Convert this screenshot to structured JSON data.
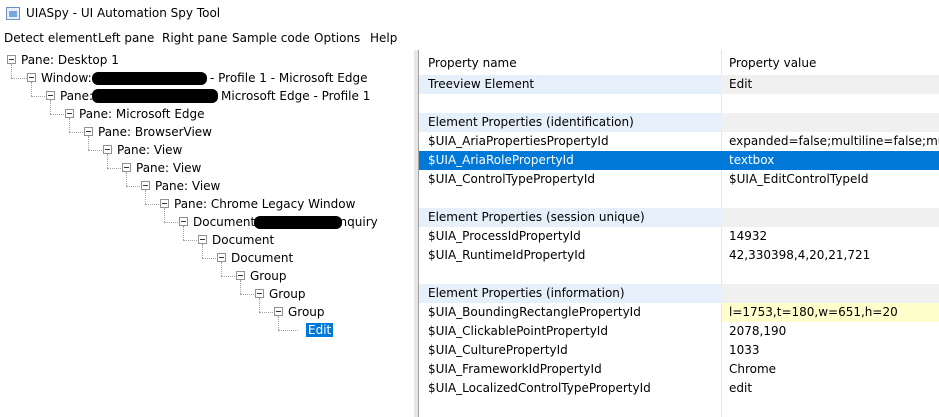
{
  "window": {
    "title": "UIASpy - UI Automation Spy Tool"
  },
  "menu": [
    {
      "label": "Detect element"
    },
    {
      "label": "Left pane"
    },
    {
      "label": "Right pane"
    },
    {
      "label": "Sample code"
    },
    {
      "label": "Options"
    },
    {
      "label": "Help"
    }
  ],
  "tree": [
    {
      "label": "Pane: Desktop 1"
    },
    {
      "label": "Window:",
      "label_suffix": "- Profile 1 - Microsoft Edge"
    },
    {
      "label": "Pane:",
      "label_suffix": "Microsoft Edge - Profile 1"
    },
    {
      "label": "Pane: Microsoft Edge"
    },
    {
      "label": "Pane: BrowserView"
    },
    {
      "label": "Pane: View"
    },
    {
      "label": "Pane: View"
    },
    {
      "label": "Pane: View"
    },
    {
      "label": "Pane: Chrome Legacy Window"
    },
    {
      "label": "Document:",
      "label_suffix": "Inquiry"
    },
    {
      "label": "Document"
    },
    {
      "label": "Document"
    },
    {
      "label": "Group"
    },
    {
      "label": "Group"
    },
    {
      "label": "Group"
    },
    {
      "label": "Edit",
      "selected": true
    }
  ],
  "grid": {
    "headers": {
      "name": "Property name",
      "value": "Property value"
    },
    "rows": [
      {
        "name": "Treeview Element",
        "value": "Edit",
        "type": "group"
      },
      {
        "name": "",
        "value": "",
        "type": "blank"
      },
      {
        "name": "Element Properties (identification)",
        "value": "",
        "type": "group"
      },
      {
        "name": "$UIA_AriaPropertiesPropertyId",
        "value": "expanded=false;multiline=false;multiselectable=false",
        "type": "normal"
      },
      {
        "name": "$UIA_AriaRolePropertyId",
        "value": "textbox",
        "type": "selected"
      },
      {
        "name": "$UIA_ControlTypePropertyId",
        "value": "$UIA_EditControlTypeId",
        "type": "normal"
      },
      {
        "name": "",
        "value": "",
        "type": "blank"
      },
      {
        "name": "Element Properties (session unique)",
        "value": "",
        "type": "group"
      },
      {
        "name": "$UIA_ProcessIdPropertyId",
        "value": "14932",
        "type": "normal"
      },
      {
        "name": "$UIA_RuntimeIdPropertyId",
        "value": "42,330398,4,20,21,721",
        "type": "normal"
      },
      {
        "name": "",
        "value": "",
        "type": "blank"
      },
      {
        "name": "Element Properties (information)",
        "value": "",
        "type": "group"
      },
      {
        "name": "$UIA_BoundingRectanglePropertyId",
        "value": "l=1753,t=180,w=651,h=20",
        "type": "highlight"
      },
      {
        "name": "$UIA_ClickablePointPropertyId",
        "value": "2078,190",
        "type": "normal"
      },
      {
        "name": "$UIA_CulturePropertyId",
        "value": "1033",
        "type": "normal"
      },
      {
        "name": "$UIA_FrameworkIdPropertyId",
        "value": "Chrome",
        "type": "normal"
      },
      {
        "name": "$UIA_LocalizedControlTypePropertyId",
        "value": "edit",
        "type": "normal"
      }
    ]
  }
}
